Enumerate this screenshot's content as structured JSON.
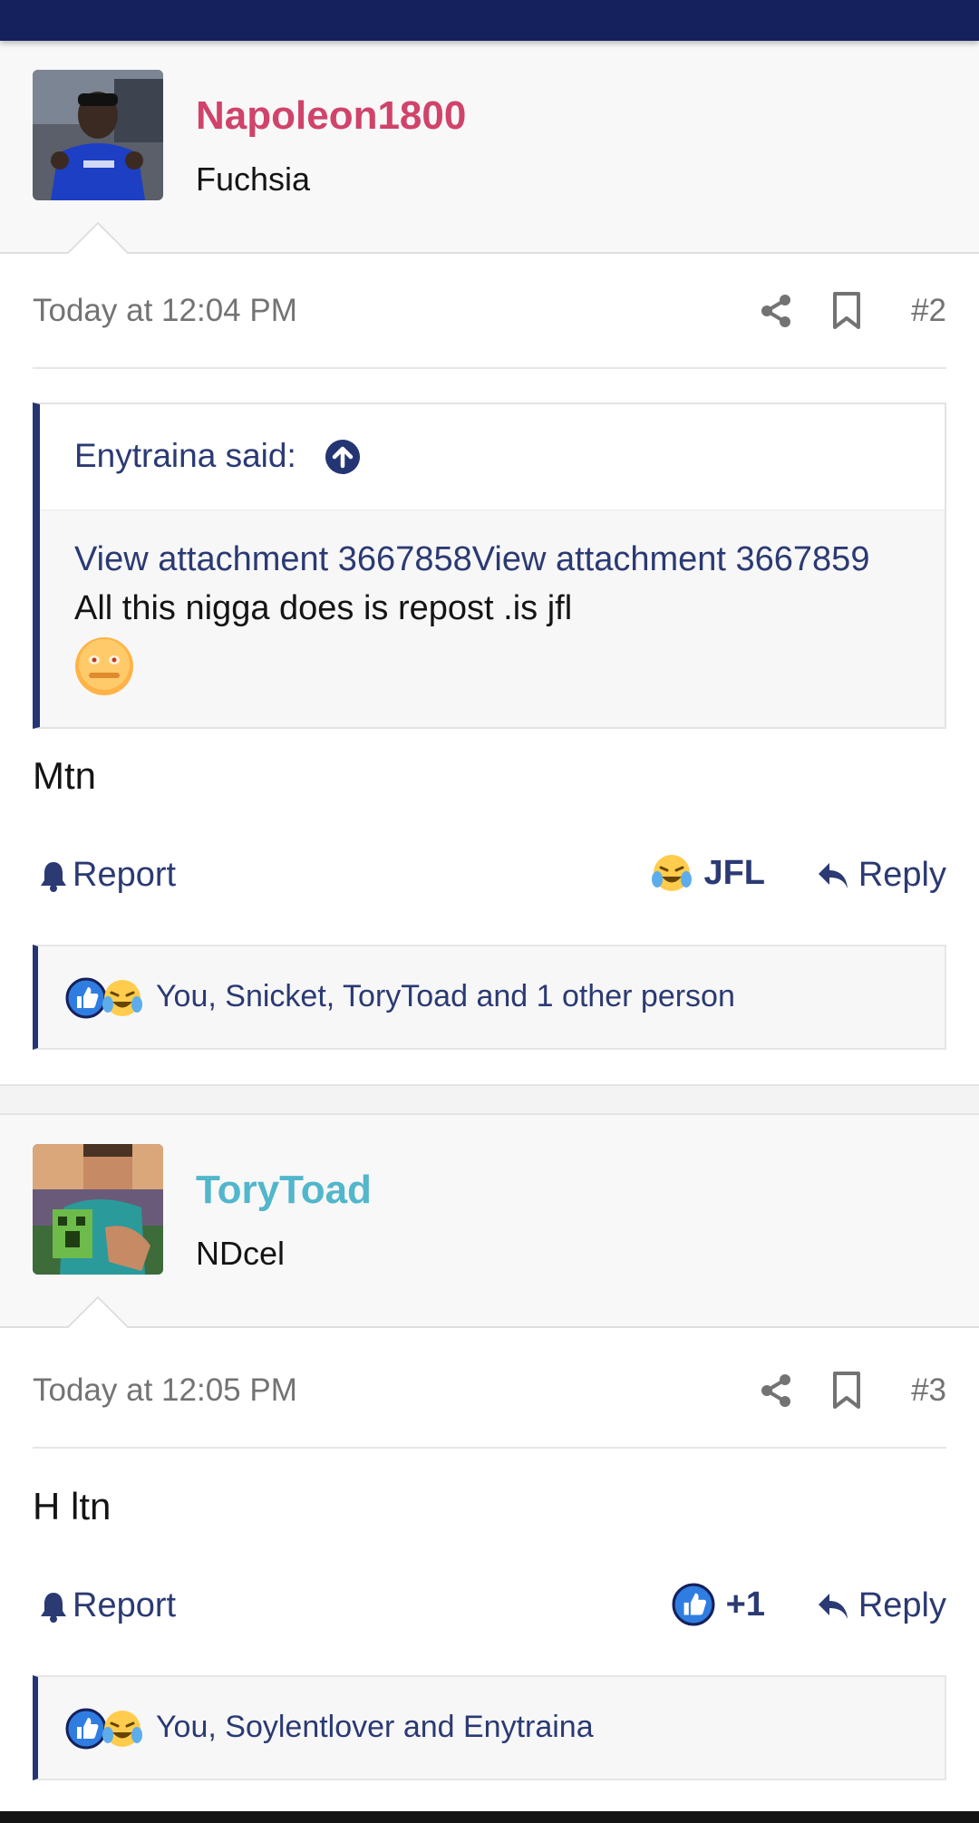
{
  "colors": {
    "topbar": "#15215c",
    "accent": "#2b3a73",
    "username_1": "#d0436a",
    "username_2": "#52b6cc",
    "meta_text": "#737373"
  },
  "posts": [
    {
      "username": "Napoleon1800",
      "user_title": "Fuchsia",
      "date": "Today at 12:04 PM",
      "post_number": "#2",
      "quote": {
        "author": "Enytraina said:",
        "attachments": "View attachment 3667858View attachment 3667859",
        "text": "All this nigga does is repost .is jfl",
        "emoji": "grimacing-face"
      },
      "body": "Mtn",
      "report_label": "Report",
      "reaction_label": "JFL",
      "reaction_icon": "laughing-crying-emoji",
      "reply_label": "Reply",
      "reactions_summary": "You, Snicket, ToryToad and 1 other person"
    },
    {
      "username": "ToryToad",
      "user_title": "NDcel",
      "date": "Today at 12:05 PM",
      "post_number": "#3",
      "body": "H ltn",
      "report_label": "Report",
      "reaction_label": "+1",
      "reaction_icon": "thumbs-up-icon",
      "reply_label": "Reply",
      "reactions_summary": "You, Soylentlover and Enytraina"
    }
  ]
}
